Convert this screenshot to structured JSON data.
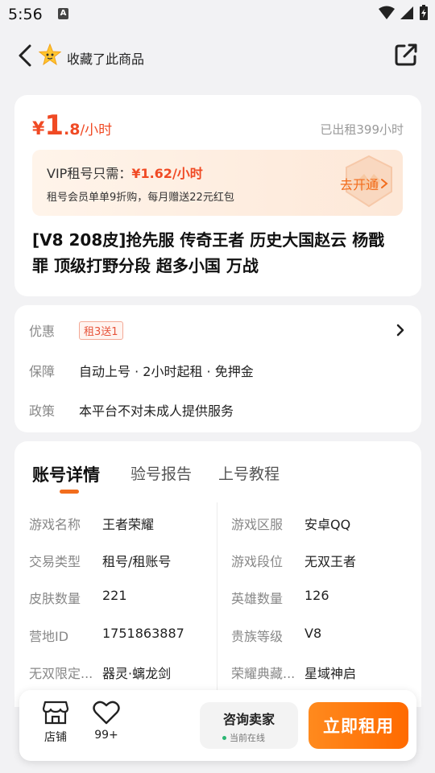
{
  "status": {
    "time": "5:56",
    "notif_icon": "A"
  },
  "header": {
    "collect_text": "收藏了此商品"
  },
  "price": {
    "symbol": "¥",
    "integer": "1",
    "decimal": ".8",
    "unit": "/小时",
    "rented": "已出租399小时"
  },
  "vip": {
    "prefix": "VIP租号只需：",
    "price": "¥1.62/小时",
    "desc": "租号会员单单9折购，每月赠送22元红包",
    "open": "去开通"
  },
  "product": {
    "title": "[V8 208皮]抢先服 传奇王者 历史大国赵云 杨戬 罪 顶级打野分段 超多小国 万战"
  },
  "info": {
    "promo_label": "优惠",
    "promo_tag": "租3送1",
    "guarantee_label": "保障",
    "guarantee_value": "自动上号 · 2小时起租 · 免押金",
    "policy_label": "政策",
    "policy_value": "本平台不对未成人提供服务"
  },
  "tabs": [
    "账号详情",
    "验号报告",
    "上号教程"
  ],
  "details": [
    {
      "label": "游戏名称",
      "value": "王者荣耀"
    },
    {
      "label": "游戏区服",
      "value": "安卓QQ"
    },
    {
      "label": "交易类型",
      "value": "租号/租账号"
    },
    {
      "label": "游戏段位",
      "value": "无双王者"
    },
    {
      "label": "皮肤数量",
      "value": "221"
    },
    {
      "label": "英雄数量",
      "value": "126"
    },
    {
      "label": "营地ID",
      "value": "1751863887"
    },
    {
      "label": "贵族等级",
      "value": "V8"
    },
    {
      "label": "无双限定...",
      "value": "器灵·螭龙剑"
    },
    {
      "label": "荣耀典藏...",
      "value": "星域神启"
    }
  ],
  "bottom": {
    "store": "店铺",
    "favorites": "99+",
    "consult": "咨询卖家",
    "online": "当前在线",
    "rent": "立即租用"
  },
  "colors": {
    "accent": "#f04a24",
    "orange": "#f26d1d",
    "bg": "#f2f2f4"
  }
}
